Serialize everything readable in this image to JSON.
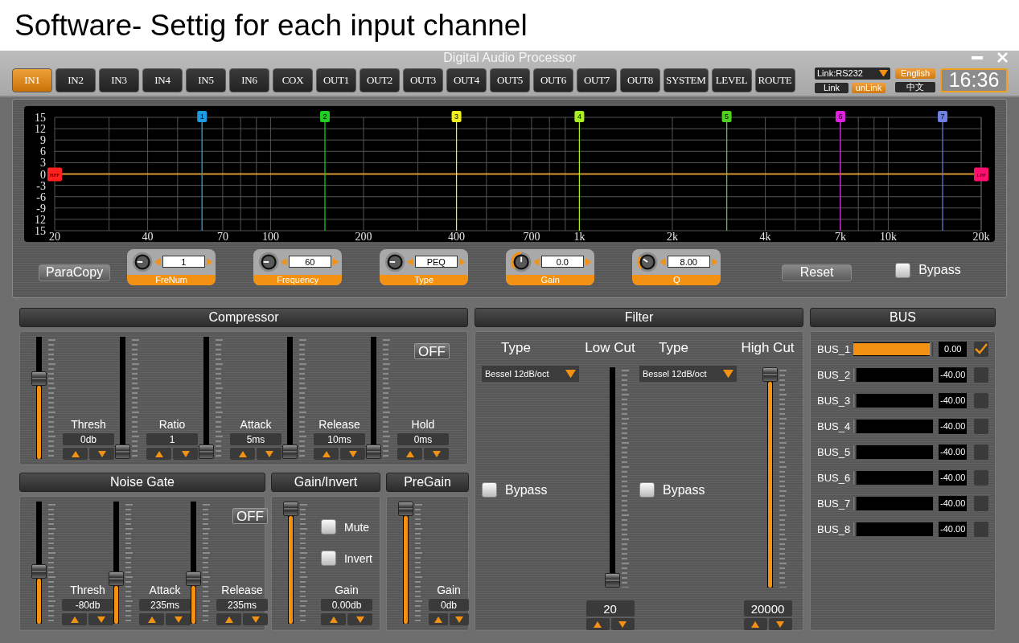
{
  "caption": "Software- Settig for each input channel",
  "window": {
    "title": "Digital Audio Processor"
  },
  "tabs": [
    {
      "label": "IN1",
      "selected": true
    },
    {
      "label": "IN2",
      "selected": false
    },
    {
      "label": "IN3",
      "selected": false
    },
    {
      "label": "IN4",
      "selected": false
    },
    {
      "label": "IN5",
      "selected": false
    },
    {
      "label": "IN6",
      "selected": false
    },
    {
      "label": "COX",
      "selected": false
    },
    {
      "label": "OUT1",
      "selected": false
    },
    {
      "label": "OUT2",
      "selected": false
    },
    {
      "label": "OUT3",
      "selected": false
    },
    {
      "label": "OUT4",
      "selected": false
    },
    {
      "label": "OUT5",
      "selected": false
    },
    {
      "label": "OUT6",
      "selected": false
    },
    {
      "label": "OUT7",
      "selected": false
    },
    {
      "label": "OUT8",
      "selected": false
    },
    {
      "label": "SYSTEM",
      "selected": false
    },
    {
      "label": "LEVEL",
      "selected": false
    },
    {
      "label": "ROUTE",
      "selected": false
    }
  ],
  "connection": {
    "port": "Link:RS232",
    "buttons": [
      {
        "label": "Link",
        "selected": false
      },
      {
        "label": "unLink",
        "selected": true
      }
    ]
  },
  "languages": [
    {
      "label": "English",
      "selected": true
    },
    {
      "label": "中文",
      "selected": false
    }
  ],
  "clock": "16:36",
  "eq": {
    "graph": {
      "y_labels": [
        "15",
        "12",
        "9",
        "6",
        "3",
        "0",
        "-3",
        "-6",
        "-9",
        "12",
        "15"
      ],
      "x_labels": [
        "20",
        "40",
        "70",
        "100",
        "200",
        "400",
        "700",
        "1k",
        "2k",
        "4k",
        "7k",
        "10k",
        "20k"
      ],
      "markers": [
        {
          "kind": "filter",
          "label": "HPF",
          "color": "#ff2020"
        },
        {
          "kind": "band",
          "label": "1",
          "color": "#1e9be0"
        },
        {
          "kind": "band",
          "label": "2",
          "color": "#20d020"
        },
        {
          "kind": "band",
          "label": "3",
          "color": "#f0f020"
        },
        {
          "kind": "band",
          "label": "4",
          "color": "#a8f020"
        },
        {
          "kind": "band",
          "label": "5",
          "color": "#50d020"
        },
        {
          "kind": "band",
          "label": "6",
          "color": "#e020e0"
        },
        {
          "kind": "band",
          "label": "7",
          "color": "#7080e0"
        },
        {
          "kind": "filter",
          "label": "LPF",
          "color": "#ff1070"
        }
      ]
    },
    "paracopy": "ParaCopy",
    "params": [
      {
        "label": "FreNum",
        "value": "1"
      },
      {
        "label": "Frequency",
        "value": "60"
      },
      {
        "label": "Type",
        "value": "PEQ"
      },
      {
        "label": "Gain",
        "value": "0.0",
        "level": 0.5
      },
      {
        "label": "Q",
        "value": "8.00",
        "level": 0.3
      }
    ],
    "reset": "Reset",
    "bypass": {
      "label": "Bypass",
      "checked": false
    }
  },
  "compressor": {
    "title": "Compressor",
    "switch": "OFF",
    "sliders": [
      {
        "label": "Thresh",
        "value": "0db",
        "level": 0.68
      },
      {
        "label": "Ratio",
        "value": "1",
        "level": 0
      },
      {
        "label": "Attack",
        "value": "5ms",
        "level": 0
      },
      {
        "label": "Release",
        "value": "10ms",
        "level": 0
      },
      {
        "label": "Hold",
        "value": "0ms",
        "level": 0
      }
    ]
  },
  "noise_gate": {
    "title": "Noise Gate",
    "switch": "OFF",
    "sliders": [
      {
        "label": "Thresh",
        "value": "-80db",
        "level": 0.42
      },
      {
        "label": "Attack",
        "value": "235ms",
        "level": 0.35
      },
      {
        "label": "Release",
        "value": "235ms",
        "level": 0.35
      }
    ]
  },
  "gain_invert": {
    "title": "Gain/Invert",
    "options": [
      {
        "label": "Mute",
        "checked": false
      },
      {
        "label": "Invert",
        "checked": false
      }
    ],
    "slider": {
      "label": "Gain",
      "value": "0.00db",
      "level": 1
    }
  },
  "pregain": {
    "title": "PreGain",
    "slider": {
      "label": "Gain",
      "value": "0db",
      "level": 1
    }
  },
  "filter": {
    "title": "Filter",
    "sections": [
      {
        "type_label": "Type",
        "cut_label": "Low Cut",
        "type_value": "Bessel 12dB/oct",
        "bypass": {
          "label": "Bypass",
          "checked": false
        },
        "value": "20",
        "level": 0
      },
      {
        "type_label": "Type",
        "cut_label": "High Cut",
        "type_value": "Bessel 12dB/oct",
        "bypass": {
          "label": "Bypass",
          "checked": false
        },
        "value": "20000",
        "level": 1
      }
    ]
  },
  "bus": {
    "title": "BUS",
    "rows": [
      {
        "label": "BUS_1",
        "level": 1,
        "value": "0.00",
        "checked": true
      },
      {
        "label": "BUS_2",
        "level": 0,
        "value": "-40.00",
        "checked": false
      },
      {
        "label": "BUS_3",
        "level": 0,
        "value": "-40.00",
        "checked": false
      },
      {
        "label": "BUS_4",
        "level": 0,
        "value": "-40.00",
        "checked": false
      },
      {
        "label": "BUS_5",
        "level": 0,
        "value": "-40.00",
        "checked": false
      },
      {
        "label": "BUS_6",
        "level": 0,
        "value": "-40.00",
        "checked": false
      },
      {
        "label": "BUS_7",
        "level": 0,
        "value": "-40.00",
        "checked": false
      },
      {
        "label": "BUS_8",
        "level": 0,
        "value": "-40.00",
        "checked": false
      }
    ]
  }
}
